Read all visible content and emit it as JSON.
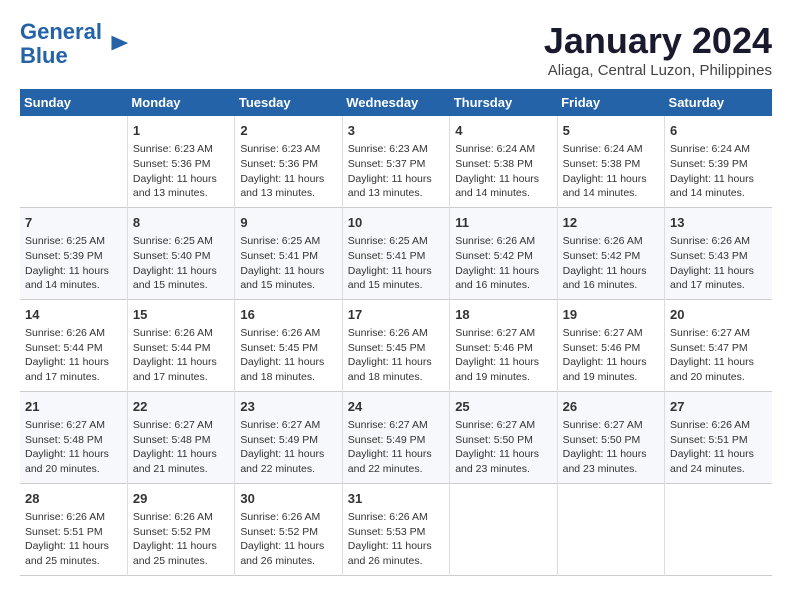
{
  "logo": {
    "line1": "General",
    "line2": "Blue"
  },
  "title": "January 2024",
  "location": "Aliaga, Central Luzon, Philippines",
  "weekdays": [
    "Sunday",
    "Monday",
    "Tuesday",
    "Wednesday",
    "Thursday",
    "Friday",
    "Saturday"
  ],
  "weeks": [
    [
      {
        "day": "",
        "info": ""
      },
      {
        "day": "1",
        "info": "Sunrise: 6:23 AM\nSunset: 5:36 PM\nDaylight: 11 hours\nand 13 minutes."
      },
      {
        "day": "2",
        "info": "Sunrise: 6:23 AM\nSunset: 5:36 PM\nDaylight: 11 hours\nand 13 minutes."
      },
      {
        "day": "3",
        "info": "Sunrise: 6:23 AM\nSunset: 5:37 PM\nDaylight: 11 hours\nand 13 minutes."
      },
      {
        "day": "4",
        "info": "Sunrise: 6:24 AM\nSunset: 5:38 PM\nDaylight: 11 hours\nand 14 minutes."
      },
      {
        "day": "5",
        "info": "Sunrise: 6:24 AM\nSunset: 5:38 PM\nDaylight: 11 hours\nand 14 minutes."
      },
      {
        "day": "6",
        "info": "Sunrise: 6:24 AM\nSunset: 5:39 PM\nDaylight: 11 hours\nand 14 minutes."
      }
    ],
    [
      {
        "day": "7",
        "info": "Sunrise: 6:25 AM\nSunset: 5:39 PM\nDaylight: 11 hours\nand 14 minutes."
      },
      {
        "day": "8",
        "info": "Sunrise: 6:25 AM\nSunset: 5:40 PM\nDaylight: 11 hours\nand 15 minutes."
      },
      {
        "day": "9",
        "info": "Sunrise: 6:25 AM\nSunset: 5:41 PM\nDaylight: 11 hours\nand 15 minutes."
      },
      {
        "day": "10",
        "info": "Sunrise: 6:25 AM\nSunset: 5:41 PM\nDaylight: 11 hours\nand 15 minutes."
      },
      {
        "day": "11",
        "info": "Sunrise: 6:26 AM\nSunset: 5:42 PM\nDaylight: 11 hours\nand 16 minutes."
      },
      {
        "day": "12",
        "info": "Sunrise: 6:26 AM\nSunset: 5:42 PM\nDaylight: 11 hours\nand 16 minutes."
      },
      {
        "day": "13",
        "info": "Sunrise: 6:26 AM\nSunset: 5:43 PM\nDaylight: 11 hours\nand 17 minutes."
      }
    ],
    [
      {
        "day": "14",
        "info": "Sunrise: 6:26 AM\nSunset: 5:44 PM\nDaylight: 11 hours\nand 17 minutes."
      },
      {
        "day": "15",
        "info": "Sunrise: 6:26 AM\nSunset: 5:44 PM\nDaylight: 11 hours\nand 17 minutes."
      },
      {
        "day": "16",
        "info": "Sunrise: 6:26 AM\nSunset: 5:45 PM\nDaylight: 11 hours\nand 18 minutes."
      },
      {
        "day": "17",
        "info": "Sunrise: 6:26 AM\nSunset: 5:45 PM\nDaylight: 11 hours\nand 18 minutes."
      },
      {
        "day": "18",
        "info": "Sunrise: 6:27 AM\nSunset: 5:46 PM\nDaylight: 11 hours\nand 19 minutes."
      },
      {
        "day": "19",
        "info": "Sunrise: 6:27 AM\nSunset: 5:46 PM\nDaylight: 11 hours\nand 19 minutes."
      },
      {
        "day": "20",
        "info": "Sunrise: 6:27 AM\nSunset: 5:47 PM\nDaylight: 11 hours\nand 20 minutes."
      }
    ],
    [
      {
        "day": "21",
        "info": "Sunrise: 6:27 AM\nSunset: 5:48 PM\nDaylight: 11 hours\nand 20 minutes."
      },
      {
        "day": "22",
        "info": "Sunrise: 6:27 AM\nSunset: 5:48 PM\nDaylight: 11 hours\nand 21 minutes."
      },
      {
        "day": "23",
        "info": "Sunrise: 6:27 AM\nSunset: 5:49 PM\nDaylight: 11 hours\nand 22 minutes."
      },
      {
        "day": "24",
        "info": "Sunrise: 6:27 AM\nSunset: 5:49 PM\nDaylight: 11 hours\nand 22 minutes."
      },
      {
        "day": "25",
        "info": "Sunrise: 6:27 AM\nSunset: 5:50 PM\nDaylight: 11 hours\nand 23 minutes."
      },
      {
        "day": "26",
        "info": "Sunrise: 6:27 AM\nSunset: 5:50 PM\nDaylight: 11 hours\nand 23 minutes."
      },
      {
        "day": "27",
        "info": "Sunrise: 6:26 AM\nSunset: 5:51 PM\nDaylight: 11 hours\nand 24 minutes."
      }
    ],
    [
      {
        "day": "28",
        "info": "Sunrise: 6:26 AM\nSunset: 5:51 PM\nDaylight: 11 hours\nand 25 minutes."
      },
      {
        "day": "29",
        "info": "Sunrise: 6:26 AM\nSunset: 5:52 PM\nDaylight: 11 hours\nand 25 minutes."
      },
      {
        "day": "30",
        "info": "Sunrise: 6:26 AM\nSunset: 5:52 PM\nDaylight: 11 hours\nand 26 minutes."
      },
      {
        "day": "31",
        "info": "Sunrise: 6:26 AM\nSunset: 5:53 PM\nDaylight: 11 hours\nand 26 minutes."
      },
      {
        "day": "",
        "info": ""
      },
      {
        "day": "",
        "info": ""
      },
      {
        "day": "",
        "info": ""
      }
    ]
  ]
}
